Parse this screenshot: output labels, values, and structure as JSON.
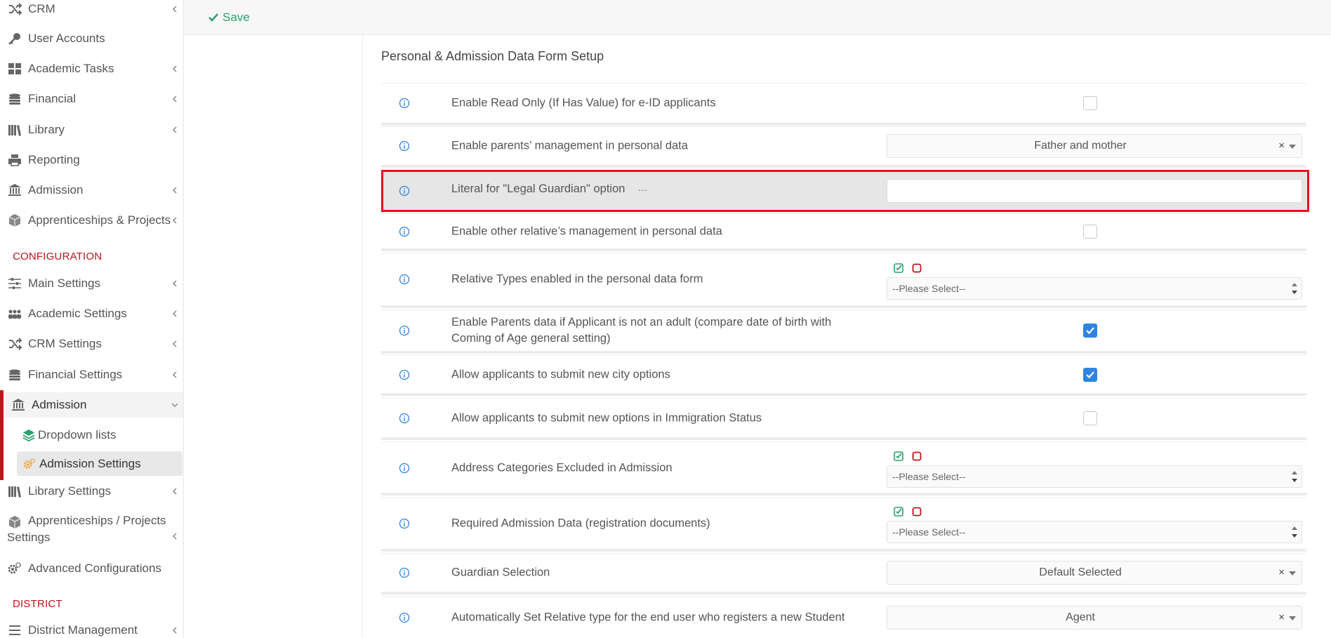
{
  "sidebar": {
    "items": [
      {
        "label": "CRM",
        "icon": "shuffle-icon",
        "chevron": true
      },
      {
        "label": "User Accounts",
        "icon": "key-icon",
        "chevron": false
      },
      {
        "label": "Academic Tasks",
        "icon": "grid-icon",
        "chevron": true
      },
      {
        "label": "Financial",
        "icon": "coins-icon",
        "chevron": true
      },
      {
        "label": "Library",
        "icon": "books-icon",
        "chevron": true
      },
      {
        "label": "Reporting",
        "icon": "printer-icon",
        "chevron": false
      },
      {
        "label": "Admission",
        "icon": "institution-icon",
        "chevron": true
      },
      {
        "label": "Apprenticeships & Projects",
        "icon": "box-icon",
        "chevron": true
      }
    ],
    "config_header": "CONFIGURATION",
    "config_items": [
      {
        "label": "Main Settings",
        "icon": "sliders-icon"
      },
      {
        "label": "Academic Settings",
        "icon": "users-icon"
      },
      {
        "label": "CRM Settings",
        "icon": "shuffle-icon"
      },
      {
        "label": "Financial Settings",
        "icon": "coins-icon"
      }
    ],
    "admission_group": {
      "label": "Admission",
      "children": [
        {
          "label": "Dropdown lists",
          "icon": "layers-icon"
        },
        {
          "label": "Admission Settings",
          "icon": "gears-icon"
        }
      ]
    },
    "more_items": [
      {
        "label": "Library Settings",
        "icon": "books-icon"
      },
      {
        "label": "Apprenticeships / Projects",
        "label2": "Settings",
        "icon": "box-icon"
      },
      {
        "label": "Advanced Configurations",
        "icon": "gears-icon"
      }
    ],
    "district_header": "DISTRICT",
    "district_items": [
      {
        "label": "District Management",
        "icon": "list-icon"
      }
    ]
  },
  "toolbar": {
    "save_label": "Save"
  },
  "page": {
    "title": "Personal & Admission Data Form Setup"
  },
  "rows": [
    {
      "label": "Enable Read Only (If Has Value) for e-ID applicants",
      "type": "checkbox",
      "checked": false
    },
    {
      "label": "Enable parents’ management in personal data",
      "type": "select",
      "value": "Father and mother"
    },
    {
      "label": "Literal for \"Legal Guardian\" option",
      "type": "text",
      "value": "",
      "ellipsis": "···"
    },
    {
      "label": "Enable other relative’s management in personal data",
      "type": "checkbox",
      "checked": false
    },
    {
      "label": "Relative Types enabled in the personal data form",
      "type": "multi",
      "placeholder": "--Please Select--"
    },
    {
      "label": "Enable Parents data if Applicant is not an adult (compare date of birth with Coming of Age general setting)",
      "type": "checkbox",
      "checked": true
    },
    {
      "label": "Allow applicants to submit new city options",
      "type": "checkbox",
      "checked": true
    },
    {
      "label": "Allow applicants to submit new options in Immigration Status",
      "type": "checkbox",
      "checked": false
    },
    {
      "label": "Address Categories Excluded in Admission",
      "type": "multi",
      "placeholder": "--Please Select--"
    },
    {
      "label": "Required Admission Data (registration documents)",
      "type": "multi",
      "placeholder": "--Please Select--"
    },
    {
      "label": "Guardian Selection",
      "type": "select",
      "value": "Default Selected"
    },
    {
      "label": "Automatically Set Relative type for the end user who registers a new Student",
      "type": "select",
      "value": "Agent"
    }
  ],
  "clear_glyph": "×",
  "colors": {
    "accent_red": "#c0131c",
    "save_green": "#2aa16e",
    "checkbox_blue": "#2f84e0",
    "highlight_red": "#e8101e"
  }
}
